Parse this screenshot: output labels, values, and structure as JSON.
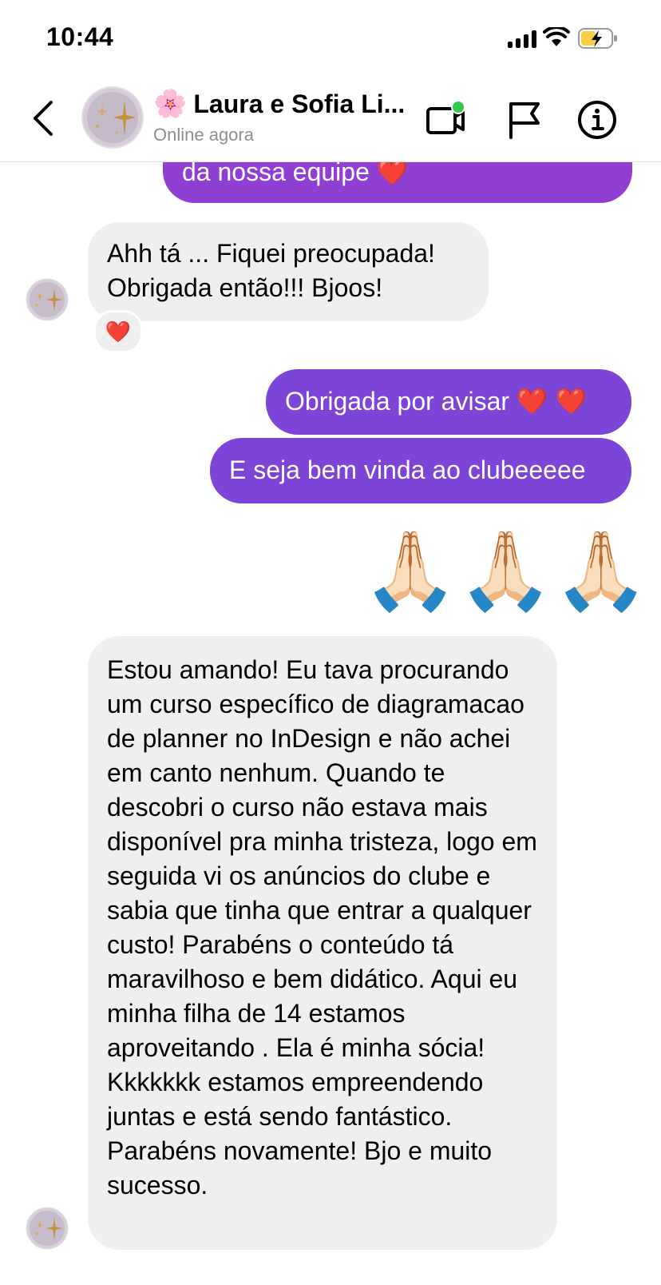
{
  "status_bar": {
    "time": "10:44"
  },
  "header": {
    "title_emoji": "🌸",
    "title": "Laura e Sofia Li...",
    "subtitle": "Online agora"
  },
  "messages": {
    "m1_partial": "da nossa equipe",
    "m1_emoji": "❤️",
    "m2_line1": "Ahh tá ... Fiquei preocupada!",
    "m2_line2": "Obrigada então!!! Bjoos!",
    "m2_reaction": "❤️",
    "m3": "Obrigada por avisar ❤️ ❤️",
    "m4": "E seja bem vinda ao clubeeeee",
    "m5": "🙏🏻🙏🏻🙏🏻",
    "m6": "Estou amando! Eu tava procurando um curso específico de diagramacao de planner no InDesign e não achei em canto nenhum. Quando te descobri o curso não estava mais disponível pra minha tristeza, logo em seguida vi os anúncios do clube e sabia que tinha que entrar a qualquer custo! Parabéns o conteúdo tá maravilhoso e bem didático. Aqui eu minha filha de 14 estamos aproveitando . Ela é minha sócia! Kkkkkkk estamos empreendendo juntas e está sendo fantástico. Parabéns novamente! Bjo e muito sucesso."
  },
  "colors": {
    "outgoing_bubble": "#8f3fd2",
    "outgoing_bubble_2": "#7d44d8",
    "incoming_bubble": "#efefef",
    "online_dot": "#32c94a",
    "battery_fill": "#f7ce46"
  },
  "icons": {
    "back": "chevron-left-icon",
    "video": "video-camera-icon",
    "flag": "flag-icon",
    "info": "info-icon"
  }
}
